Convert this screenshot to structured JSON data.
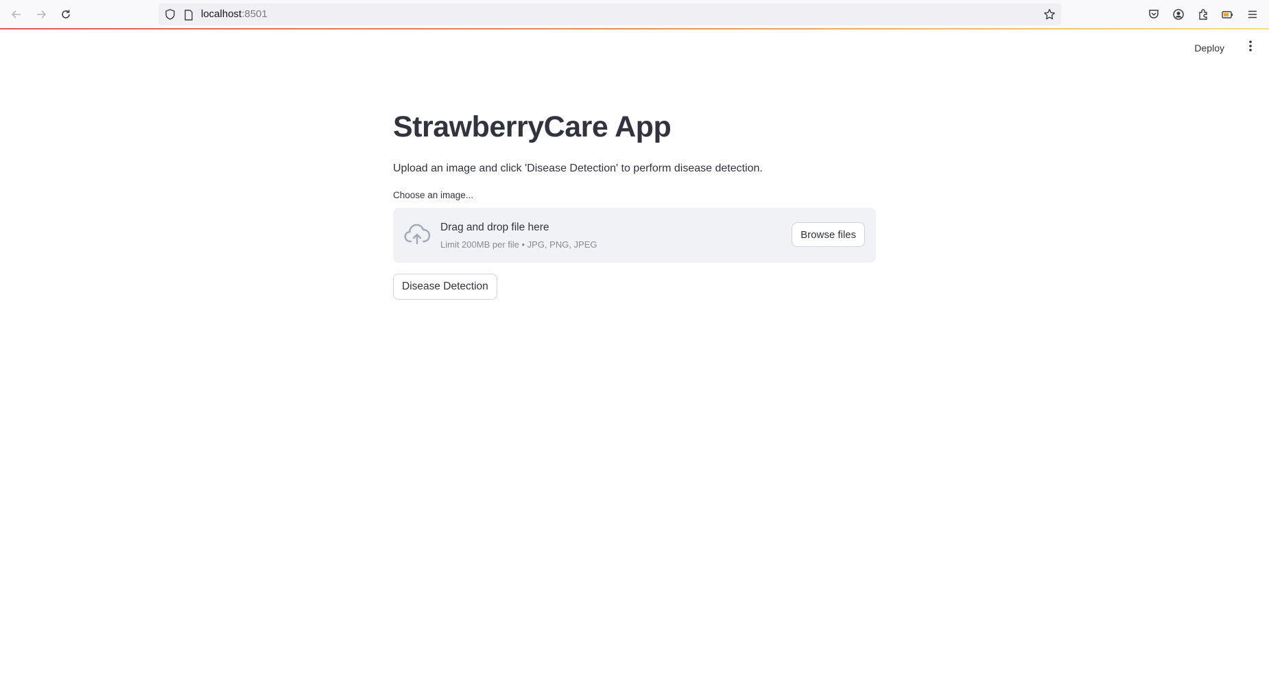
{
  "browser": {
    "url_host": "localhost",
    "url_port": ":8501"
  },
  "header": {
    "deploy_label": "Deploy"
  },
  "main": {
    "title": "StrawberryCare App",
    "intro": "Upload an image and click 'Disease Detection' to perform disease detection.",
    "uploader": {
      "label": "Choose an image...",
      "drop_text": "Drag and drop file here",
      "limit_text": "Limit 200MB per file • JPG, PNG, JPEG",
      "browse_label": "Browse files"
    },
    "detect_button_label": "Disease Detection"
  }
}
